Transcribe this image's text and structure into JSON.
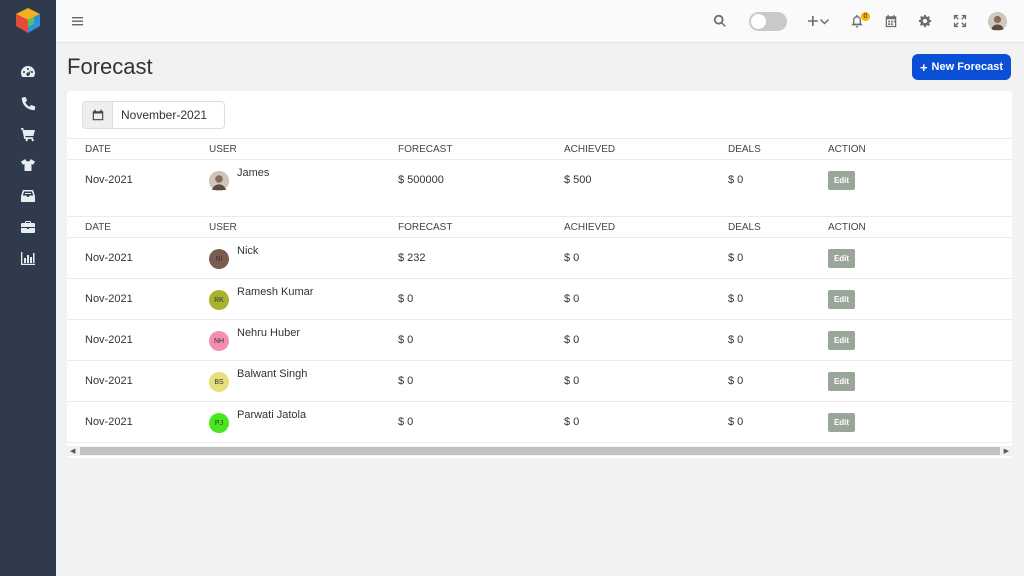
{
  "colors": {
    "sidebar": "#2f3b4c",
    "primary": "#0b4fd6",
    "edit": "#9aa69a"
  },
  "topbar": {
    "notification_count": "0"
  },
  "header": {
    "title": "Forecast",
    "new_button": "New Forecast"
  },
  "filter": {
    "month": "November-2021"
  },
  "columns": {
    "date": "DATE",
    "user": "USER",
    "forecast": "FORECAST",
    "achieved": "ACHIEVED",
    "deals": "DEALS",
    "action": "ACTION"
  },
  "group1": [
    {
      "date": "Nov-2021",
      "user": "James",
      "initials": "",
      "avatar_color": "#b8aea4",
      "forecast": "$ 500000",
      "achieved": "$ 500",
      "deals": "$ 0",
      "action": "Edit"
    }
  ],
  "group2": [
    {
      "date": "Nov-2021",
      "user": "Nick",
      "initials": "NI",
      "avatar_color": "#7a5c50",
      "forecast": "$ 232",
      "achieved": "$ 0",
      "deals": "$ 0",
      "action": "Edit"
    },
    {
      "date": "Nov-2021",
      "user": "Ramesh Kumar",
      "initials": "RK",
      "avatar_color": "#a8b22c",
      "forecast": "$ 0",
      "achieved": "$ 0",
      "deals": "$ 0",
      "action": "Edit"
    },
    {
      "date": "Nov-2021",
      "user": "Nehru Huber",
      "initials": "NH",
      "avatar_color": "#f28fb1",
      "forecast": "$ 0",
      "achieved": "$ 0",
      "deals": "$ 0",
      "action": "Edit"
    },
    {
      "date": "Nov-2021",
      "user": "Balwant Singh",
      "initials": "BS",
      "avatar_color": "#e6e07a",
      "forecast": "$ 0",
      "achieved": "$ 0",
      "deals": "$ 0",
      "action": "Edit"
    },
    {
      "date": "Nov-2021",
      "user": "Parwati Jatola",
      "initials": "PJ",
      "avatar_color": "#49e51e",
      "forecast": "$ 0",
      "achieved": "$ 0",
      "deals": "$ 0",
      "action": "Edit"
    }
  ]
}
